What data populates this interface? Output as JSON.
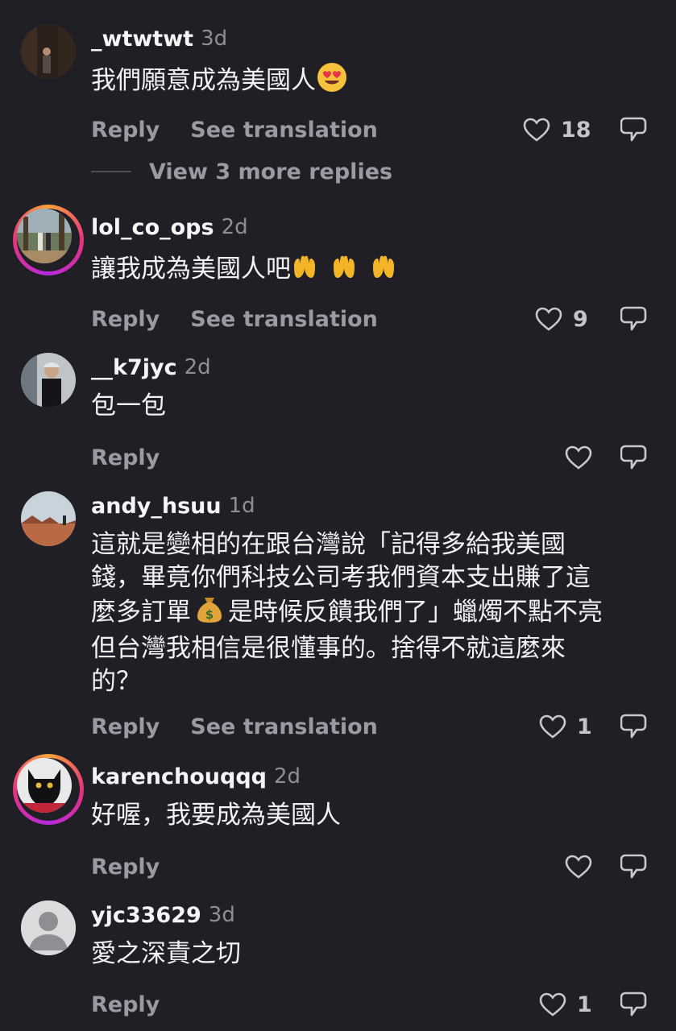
{
  "comments": [
    {
      "username": "_wtwtwt",
      "time": "3d",
      "text": "我們願意成為美國人",
      "emoji": "heart-eyes",
      "reply": "Reply",
      "translate": "See translation",
      "likes": "18",
      "more_replies": "View 3 more replies"
    },
    {
      "username": "lol_co_ops",
      "time": "2d",
      "text": "讓我成為美國人吧",
      "emoji": "raised-hands x3",
      "reply": "Reply",
      "translate": "See translation",
      "likes": "9"
    },
    {
      "username": "__k7jyc",
      "time": "2d",
      "text": "包一包",
      "reply": "Reply"
    },
    {
      "username": "andy_hsuu",
      "time": "1d",
      "text_lines": [
        "這就是變相的在跟台灣說「記得多給我美國",
        "錢，畢竟你們科技公司考我們資本支出賺了這",
        "麼多訂單",
        "是時候反饋我們了」蠟燭不點不亮",
        "但台灣我相信是很懂事的。捨得不就這麼來",
        "的？"
      ],
      "emoji": "money-bag",
      "reply": "Reply",
      "translate": "See translation",
      "likes": "1"
    },
    {
      "username": "karenchouqqq",
      "time": "2d",
      "text": "好喔，我要成為美國人",
      "reply": "Reply"
    },
    {
      "username": "yjc33629",
      "time": "3d",
      "text": "愛之深責之切",
      "reply": "Reply",
      "likes": "1"
    }
  ],
  "icons": {
    "like": "heart-outline-icon",
    "dislike": "thumb-down-speech-icon"
  },
  "colors": {
    "background": "#1f1f25",
    "text": "#f2f2f4",
    "muted": "#9a9aa2",
    "ring_gradient": [
      "#f9a23a",
      "#e8327a",
      "#b62adf"
    ]
  }
}
